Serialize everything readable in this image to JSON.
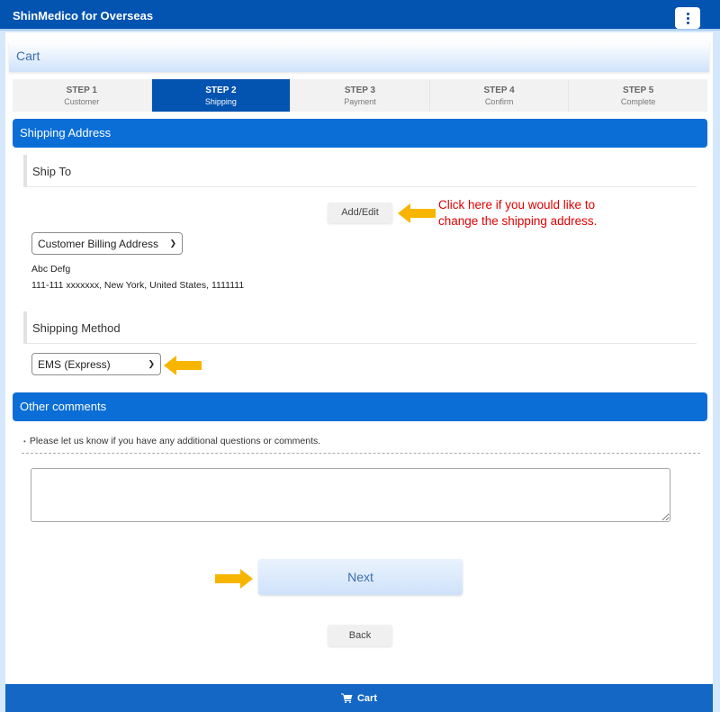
{
  "app": {
    "title": "ShinMedico for Overseas",
    "menu_icon": "kebab-menu-icon"
  },
  "cart": {
    "heading": "Cart"
  },
  "steps": [
    {
      "num": "STEP 1",
      "label": "Customer",
      "active": false
    },
    {
      "num": "STEP 2",
      "label": "Shipping",
      "active": true
    },
    {
      "num": "STEP 3",
      "label": "Payment",
      "active": false
    },
    {
      "num": "STEP 4",
      "label": "Confirm",
      "active": false
    },
    {
      "num": "STEP 5",
      "label": "Complete",
      "active": false
    }
  ],
  "shipping_address": {
    "section_title": "Shipping Address",
    "ship_to_label": "Ship To",
    "add_edit_label": "Add/Edit",
    "annotation": "Click here if you would like to change the shipping address.",
    "annotation_line1": "Click here if you would like to",
    "annotation_line2": "change the shipping address.",
    "address_select": {
      "selected": "Customer Billing Address"
    },
    "name": "Abc Defg",
    "address_line": "111-111 xxxxxxx, New York, United States, 1111111"
  },
  "shipping_method": {
    "label": "Shipping Method",
    "select": {
      "selected": "EMS (Express)"
    }
  },
  "other_comments": {
    "section_title": "Other comments",
    "note": "Please let us know if you have any additional questions or comments.",
    "bullet": "•",
    "textarea_value": ""
  },
  "actions": {
    "next_label": "Next",
    "back_label": "Back"
  },
  "footer": {
    "cart_label": "Cart",
    "cart_icon": "shopping-cart-icon"
  },
  "colors": {
    "header_blue": "#0353b0",
    "section_blue": "#0a6ed6",
    "footer_blue": "#1467c4",
    "annotation_red": "#e00000",
    "arrow_yellow": "#f8b500"
  }
}
